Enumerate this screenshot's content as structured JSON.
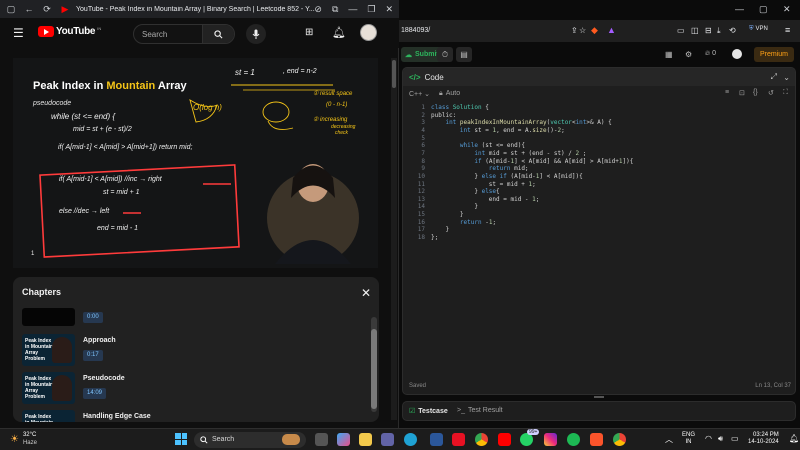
{
  "youtube": {
    "tab_title": "YouTube - Peak Index in Mountain Array | Binary Search | Leetcode 852 - Y...",
    "logo_text": "YouTube",
    "logo_country": "IN",
    "search_placeholder": "Search",
    "video": {
      "heading_part1": "Peak Index in ",
      "heading_part2": "Mountain",
      "heading_part3": " Array",
      "label_pseudocode": "pseudocode",
      "notes": {
        "st_eq": "st = 1",
        "end_eq": ", end = n-2",
        "ologn": "O(log n)",
        "c1": "① result space",
        "c1b": "(0 - n-1)",
        "c2": "② increasing",
        "c2b": "decreasing",
        "c2c": "check",
        "while": "while (st <= end) {",
        "mid": "mid = st + (e - st)/2",
        "if1": "if( A[mid-1] < A[mid] > A[mid+1]) return mid;",
        "if2": "if( A[mid-1] < A[mid]) //inc → right",
        "st_mid": "st = mid + 1",
        "else": "else //dec → left",
        "end_mid": "end = mid - 1",
        "one": "1"
      }
    },
    "chapters": {
      "title": "Chapters",
      "items": [
        {
          "title": "",
          "time": "0:00",
          "thumb_text": ""
        },
        {
          "title": "Approach",
          "time": "0:17",
          "thumb_text": "Peak Index in Mountain Array Problem"
        },
        {
          "title": "Pseudocode",
          "time": "14:09",
          "thumb_text": "Peak Index in Mountain Array Problem"
        },
        {
          "title": "Handling Edge Case",
          "time": "",
          "thumb_text": "Peak Index in Mountain"
        }
      ]
    }
  },
  "leetcode": {
    "url": "1884093/",
    "submit_label": "Submit",
    "likes": "0",
    "premium_label": "Premium",
    "vpn_label": "VPN",
    "code_tab_label": "Code",
    "language": "C++",
    "auto_label": "Auto",
    "saved_label": "Saved",
    "cursor_position": "Ln 13, Col 37",
    "testcase_label": "Testcase",
    "test_result_label": "Test Result",
    "code_lines": [
      "class Solution {",
      "public:",
      "    int peakIndexInMountainArray(vector<int>& A) {",
      "        int st = 1, end = A.size()-2;",
      "",
      "        while (st <= end){",
      "            int mid = st + (end - st) / 2 ;",
      "            if (A[mid-1] < A[mid] && A[mid] > A[mid+1]){",
      "                return mid;",
      "            } else if (A[mid-1] < A[mid]){",
      "                st = mid + 1;",
      "            } else{",
      "                end = mid - 1;",
      "            }",
      "        }",
      "        return -1;",
      "    }",
      "};"
    ]
  },
  "taskbar": {
    "weather_temp": "32°C",
    "weather_desc": "Haze",
    "search_label": "Search",
    "lang_top": "ENG",
    "lang_bottom": "IN",
    "time": "03:24 PM",
    "date": "14-10-2024",
    "badge": "99+"
  },
  "colors": {
    "accent_yellow": "#f5c518",
    "youtube_red": "#ff0000",
    "leetcode_orange": "#ffa116",
    "submit_green": "#2db55d",
    "chalk_red": "#ff3b3b"
  }
}
